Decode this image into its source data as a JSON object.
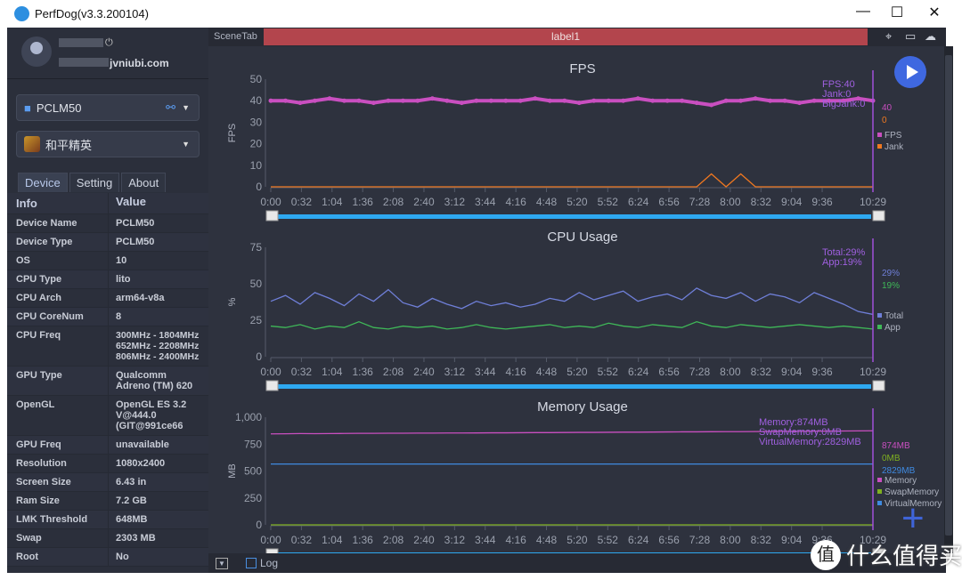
{
  "window": {
    "title": "PerfDog(v3.3.200104)",
    "minimize": "—",
    "maximize": "☐",
    "close": "✕"
  },
  "user": {
    "email": "jvniubi.com"
  },
  "device_select": {
    "value": "PCLM50"
  },
  "app_select": {
    "value": "和平精英"
  },
  "tabs": [
    "Device",
    "Setting",
    "About"
  ],
  "table": {
    "headers": [
      "Info",
      "Value"
    ],
    "rows": [
      [
        "Device Name",
        "PCLM50"
      ],
      [
        "Device Type",
        "PCLM50"
      ],
      [
        "OS",
        "10"
      ],
      [
        "CPU Type",
        "lito"
      ],
      [
        "CPU Arch",
        "arm64-v8a"
      ],
      [
        "CPU CoreNum",
        "8"
      ],
      [
        "CPU Freq",
        "300MHz - 1804MHz\n652MHz - 2208MHz\n806MHz - 2400MHz"
      ],
      [
        "GPU Type",
        "Qualcomm Adreno (TM) 620"
      ],
      [
        "OpenGL",
        "OpenGL ES 3.2 V@444.0 (GIT@991ce66"
      ],
      [
        "GPU Freq",
        "unavailable"
      ],
      [
        "Resolution",
        "1080x2400"
      ],
      [
        "Screen Size",
        "6.43 in"
      ],
      [
        "Ram Size",
        "7.2 GB"
      ],
      [
        "LMK Threshold",
        "648MB"
      ],
      [
        "Swap",
        "2303 MB"
      ],
      [
        "Root",
        "No"
      ]
    ]
  },
  "topbar": {
    "scene_tab": "SceneTab",
    "label": "label1"
  },
  "bottom": {
    "log_label": "Log"
  },
  "watermark": "什么值得买",
  "chart_data": [
    {
      "type": "line",
      "title": "FPS",
      "ylabel": "FPS",
      "ylim": [
        0,
        50
      ],
      "yticks": [
        0,
        10,
        20,
        30,
        40,
        50
      ],
      "xticks": [
        "0:00",
        "0:32",
        "1:04",
        "1:36",
        "2:08",
        "2:40",
        "3:12",
        "3:44",
        "4:16",
        "4:48",
        "5:20",
        "5:52",
        "6:24",
        "6:56",
        "7:28",
        "8:00",
        "8:32",
        "9:04",
        "9:36",
        "10:29"
      ],
      "xrange": [
        "0:00",
        "10:29"
      ],
      "tooltip": [
        "FPS:40",
        "Jank:0",
        "BigJank:0"
      ],
      "current": [
        "40",
        "0"
      ],
      "series": [
        {
          "name": "FPS",
          "color": "#c94fc0",
          "values": [
            40,
            40,
            39,
            40,
            41,
            40,
            40,
            39,
            40,
            40,
            40,
            41,
            40,
            39,
            40,
            40,
            40,
            40,
            41,
            40,
            40,
            39,
            40,
            40,
            40,
            41,
            40,
            40,
            40,
            39,
            38,
            40,
            40,
            41,
            40,
            40,
            39,
            40,
            40,
            40,
            41,
            40
          ]
        },
        {
          "name": "Jank",
          "color": "#f07820",
          "values": [
            0,
            0,
            0,
            0,
            0,
            0,
            0,
            0,
            0,
            0,
            0,
            0,
            0,
            0,
            0,
            0,
            0,
            0,
            0,
            0,
            0,
            0,
            0,
            0,
            0,
            0,
            0,
            0,
            0,
            0,
            6,
            0,
            6,
            0,
            0,
            0,
            0,
            0,
            0,
            0,
            0,
            0
          ]
        }
      ]
    },
    {
      "type": "line",
      "title": "CPU Usage",
      "ylabel": "%",
      "ylim": [
        0,
        75
      ],
      "yticks": [
        0,
        25,
        50,
        75
      ],
      "xticks": [
        "0:00",
        "0:32",
        "1:04",
        "1:36",
        "2:08",
        "2:40",
        "3:12",
        "3:44",
        "4:16",
        "4:48",
        "5:20",
        "5:52",
        "6:24",
        "6:56",
        "7:28",
        "8:00",
        "8:32",
        "9:04",
        "9:36",
        "10:29"
      ],
      "xrange": [
        "0:00",
        "10:29"
      ],
      "tooltip": [
        "Total:29%",
        "App:19%"
      ],
      "current": [
        "29%",
        "19%"
      ],
      "series": [
        {
          "name": "Total",
          "color": "#6f7fd8",
          "values": [
            38,
            42,
            36,
            44,
            40,
            35,
            43,
            38,
            46,
            37,
            34,
            40,
            36,
            33,
            38,
            35,
            37,
            34,
            36,
            40,
            38,
            44,
            39,
            42,
            45,
            38,
            41,
            43,
            39,
            47,
            42,
            40,
            44,
            38,
            43,
            41,
            37,
            44,
            40,
            36,
            31,
            29
          ]
        },
        {
          "name": "App",
          "color": "#3fb858",
          "values": [
            21,
            20,
            22,
            19,
            21,
            20,
            24,
            20,
            19,
            21,
            20,
            21,
            19,
            20,
            22,
            20,
            19,
            20,
            21,
            22,
            20,
            21,
            20,
            23,
            21,
            20,
            22,
            21,
            20,
            24,
            21,
            20,
            22,
            21,
            20,
            21,
            22,
            21,
            20,
            21,
            20,
            19
          ]
        }
      ]
    },
    {
      "type": "line",
      "title": "Memory Usage",
      "ylabel": "MB",
      "ylim": [
        0,
        1000
      ],
      "yticks": [
        0,
        250,
        500,
        750,
        "1,000"
      ],
      "xticks": [
        "0:00",
        "0:32",
        "1:04",
        "1:36",
        "2:08",
        "2:40",
        "3:12",
        "3:44",
        "4:16",
        "4:48",
        "5:20",
        "5:52",
        "6:24",
        "6:56",
        "7:28",
        "8:00",
        "8:32",
        "9:04",
        "9:36",
        "10:29"
      ],
      "xrange": [
        "0:00",
        "10:29"
      ],
      "tooltip": [
        "Memory:874MB",
        "SwapMemory:0MB",
        "VirtualMemory:2829MB"
      ],
      "current": [
        "874MB",
        "0MB",
        "2829MB"
      ],
      "series": [
        {
          "name": "Memory",
          "color": "#c94fc0",
          "values": [
            845,
            846,
            848,
            847,
            848,
            849,
            850,
            850,
            851,
            851,
            852,
            852,
            853,
            853,
            854,
            855,
            855,
            856,
            857,
            857,
            858,
            859,
            859,
            860,
            861,
            861,
            862,
            863,
            864,
            864,
            865,
            866,
            866,
            867,
            868,
            869,
            869,
            870,
            871,
            872,
            873,
            874
          ]
        },
        {
          "name": "SwapMemory",
          "color": "#7fb020",
          "values": [
            0,
            0,
            0,
            0,
            0,
            0,
            0,
            0,
            0,
            0,
            0,
            0,
            0,
            0,
            0,
            0,
            0,
            0,
            0,
            0,
            0,
            0,
            0,
            0,
            0,
            0,
            0,
            0,
            0,
            0,
            0,
            0,
            0,
            0,
            0,
            0,
            0,
            0,
            0,
            0,
            0,
            0
          ]
        },
        {
          "name": "VirtualMemory",
          "color": "#3f8ae0",
          "values": [
            565,
            565,
            565,
            565,
            565,
            565,
            565,
            565,
            565,
            565,
            565,
            565,
            565,
            565,
            565,
            565,
            565,
            565,
            565,
            565,
            565,
            565,
            565,
            565,
            565,
            565,
            565,
            565,
            565,
            565,
            565,
            565,
            565,
            565,
            565,
            565,
            565,
            565,
            565,
            565,
            565,
            565
          ]
        }
      ]
    }
  ]
}
